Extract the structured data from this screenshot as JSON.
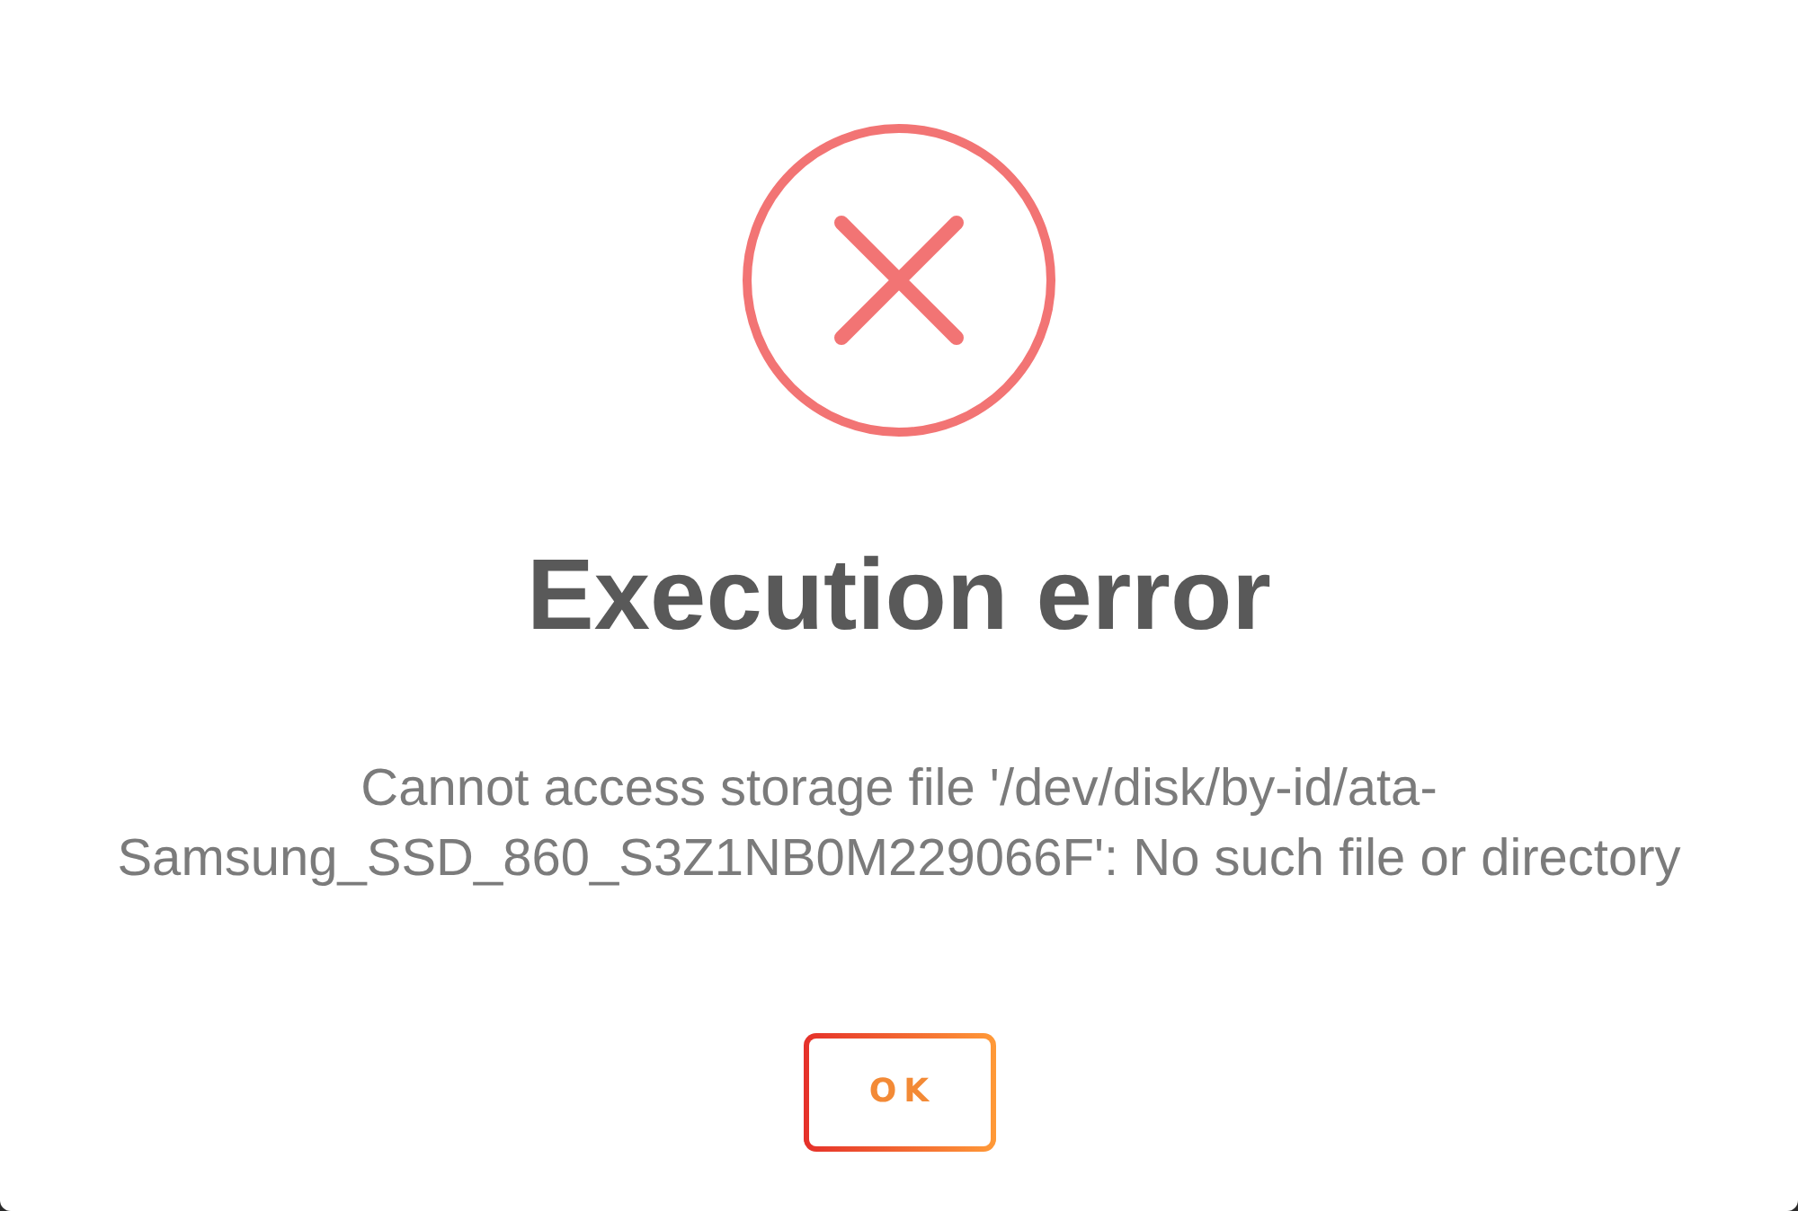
{
  "dialog": {
    "title": "Execution error",
    "message": "Cannot access storage file '/dev/disk/by-id/ata-Samsung_SSD_860_S3Z1NB0M229066F': No such file or directory",
    "buttons": [
      {
        "label": "OK"
      }
    ]
  }
}
